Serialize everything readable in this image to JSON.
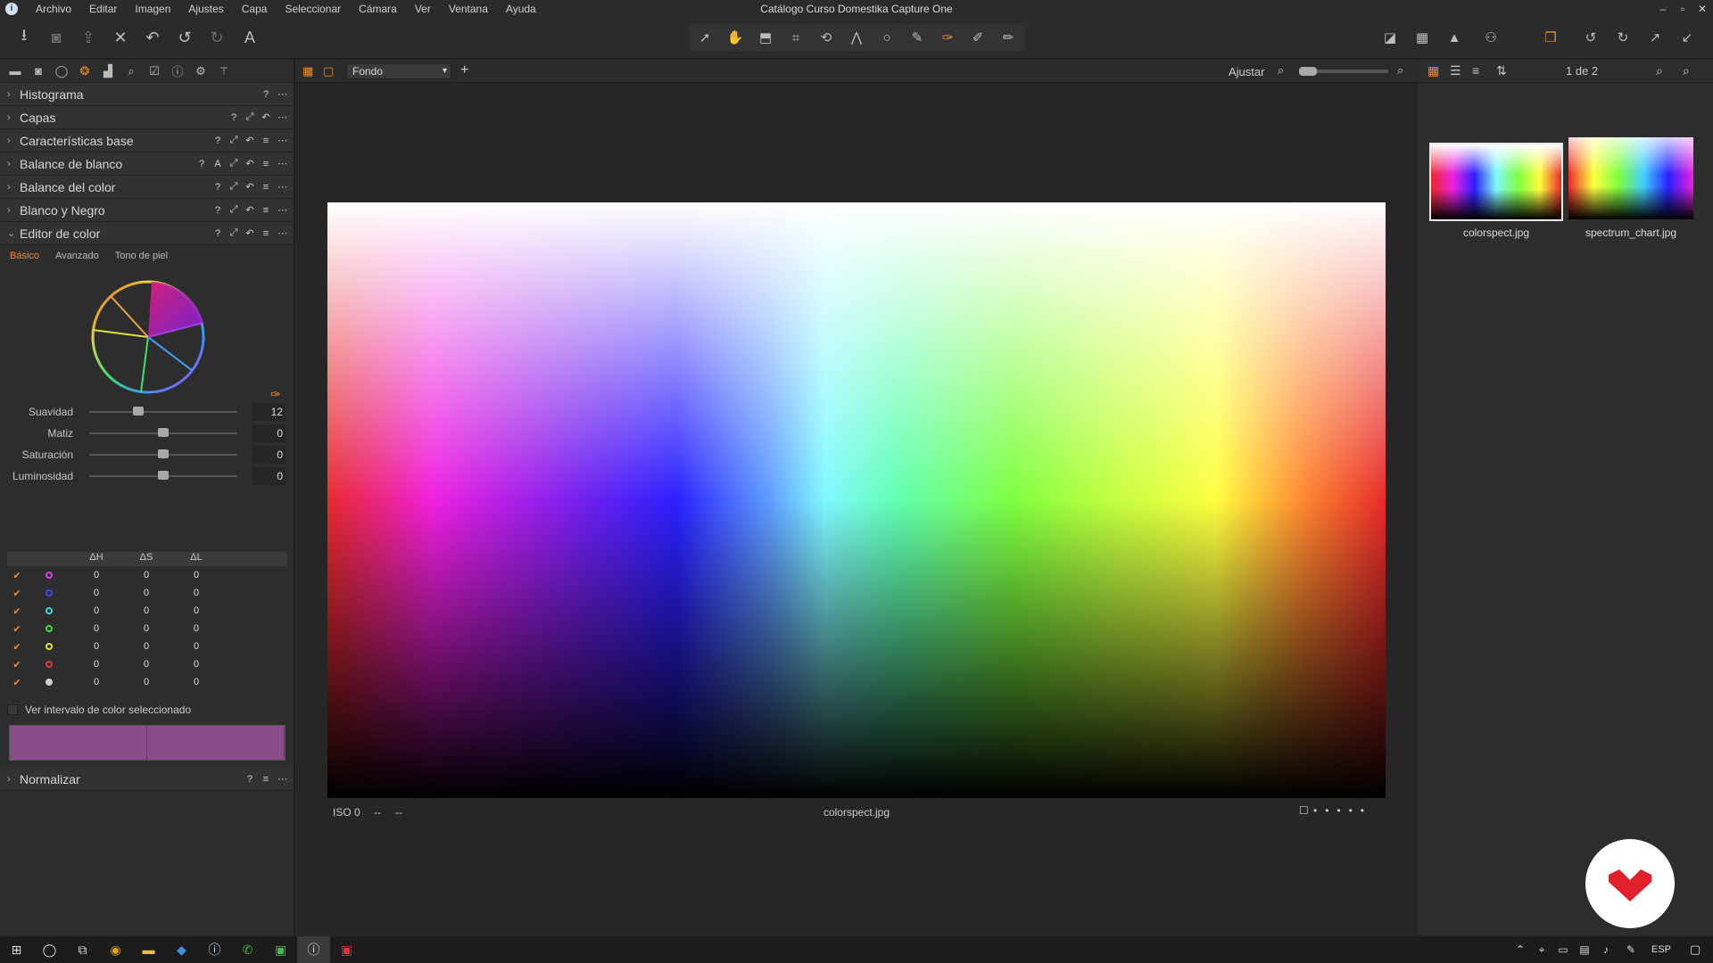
{
  "app": {
    "title": "Catálogo Curso Domestika Capture One"
  },
  "menu": [
    "Archivo",
    "Editar",
    "Imagen",
    "Ajustes",
    "Capa",
    "Seleccionar",
    "Cámara",
    "Ver",
    "Ventana",
    "Ayuda"
  ],
  "viewer_bar": {
    "layer_select": "Fondo",
    "fit_label": "Ajustar",
    "page_counter": "1 de 2"
  },
  "left_panel": {
    "sections_top": [
      {
        "label": "Histograma"
      },
      {
        "label": "Capas"
      },
      {
        "label": "Características base"
      },
      {
        "label": "Balance de blanco"
      },
      {
        "label": "Balance del color"
      },
      {
        "label": "Blanco y Negro"
      },
      {
        "label": "Editor de color"
      }
    ],
    "subtabs": [
      "Básico",
      "Avanzado",
      "Tono de piel"
    ],
    "sliders": [
      {
        "label": "Suavidad",
        "value": "12",
        "position": 0.33
      },
      {
        "label": "Matiz",
        "value": "0",
        "position": 0.5
      },
      {
        "label": "Saturación",
        "value": "0",
        "position": 0.5
      },
      {
        "label": "Luminosidad",
        "value": "0",
        "position": 0.5
      }
    ],
    "table_headers": [
      "",
      "",
      "ΔH",
      "ΔS",
      "ΔL"
    ],
    "table_rows": [
      {
        "color": "#e040e0",
        "dh": "0",
        "ds": "0",
        "dl": "0"
      },
      {
        "color": "#4a40ff",
        "dh": "0",
        "ds": "0",
        "dl": "0"
      },
      {
        "color": "#40d8e0",
        "dh": "0",
        "ds": "0",
        "dl": "0"
      },
      {
        "color": "#40e040",
        "dh": "0",
        "ds": "0",
        "dl": "0"
      },
      {
        "color": "#e8e040",
        "dh": "0",
        "ds": "0",
        "dl": "0"
      },
      {
        "color": "#e03838",
        "dh": "0",
        "ds": "0",
        "dl": "0"
      },
      {
        "color": "#cfcfcf",
        "dh": "0",
        "ds": "0",
        "dl": "0"
      }
    ],
    "show_range_label": "Ver intervalo de color seleccionado",
    "section_bottom": "Normalizar"
  },
  "photo": {
    "iso": "ISO 0",
    "field2": "--",
    "field3": "--",
    "filename": "colorspect.jpg"
  },
  "thumbnails": [
    {
      "name": "colorspect.jpg",
      "selected": true
    },
    {
      "name": "spectrum_chart.jpg",
      "selected": false
    }
  ],
  "taskbar": {
    "language": "ESP"
  },
  "colors": {
    "accent": "#f08c2a",
    "swatch": "#8c4b8c"
  }
}
